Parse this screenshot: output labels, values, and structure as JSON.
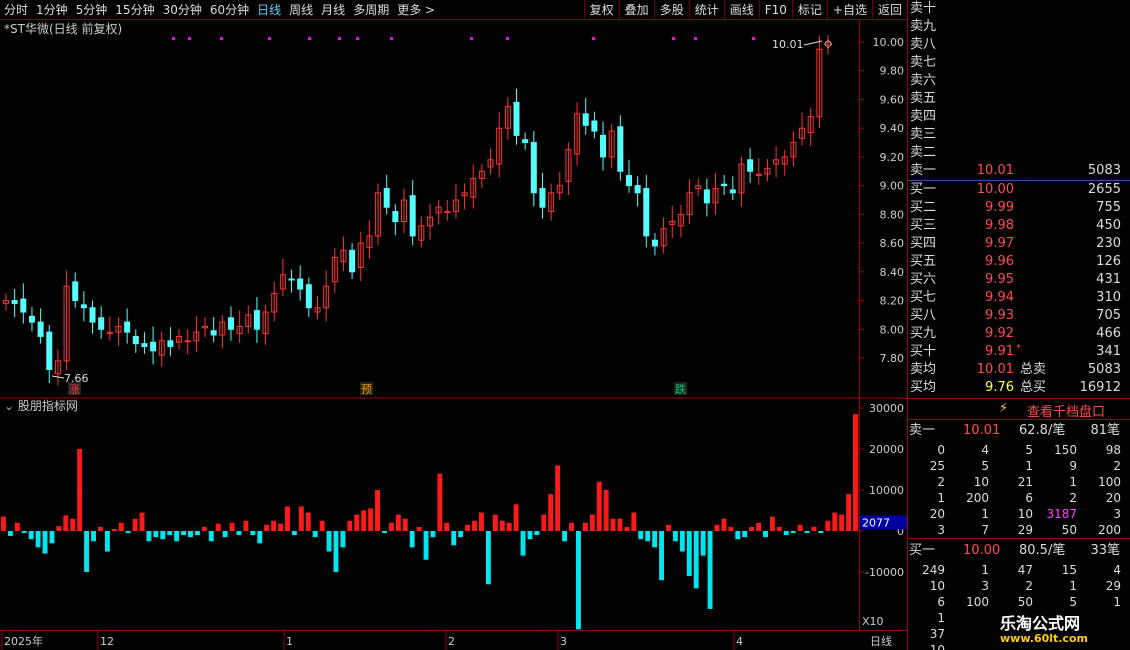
{
  "toolbar": {
    "periods": [
      "分时",
      "1分钟",
      "5分钟",
      "15分钟",
      "30分钟",
      "60分钟",
      "日线",
      "周线",
      "月线",
      "多周期",
      "更多 >"
    ],
    "active_period": "日线",
    "tools": [
      "复权",
      "叠加",
      "多股",
      "统计",
      "画线",
      "F10",
      "标记",
      "+自选",
      "返回"
    ]
  },
  "chart": {
    "title": "*ST华微(日线 前复权)",
    "high_label": "10.01",
    "low_label": "7.66",
    "markers": [
      {
        "text": "涨",
        "color": "#ff4040"
      },
      {
        "text": "预",
        "color": "#ff9900"
      },
      {
        "text": "跌",
        "color": "#00cc66"
      }
    ],
    "price_ticks": [
      "10.00",
      "9.80",
      "9.60",
      "9.40",
      "9.20",
      "9.00",
      "8.80",
      "8.60",
      "8.40",
      "8.20",
      "8.00",
      "7.80"
    ],
    "up_color": "#ff3333",
    "down_color": "#54ffff"
  },
  "indicator": {
    "title": "股朋指标网",
    "ticks": [
      "30000",
      "20000",
      "10000",
      "0",
      "-10000"
    ],
    "current_value": "2077",
    "scale_label": "X10"
  },
  "xaxis": {
    "labels": [
      "2025年",
      "12",
      "1",
      "2",
      "3",
      "4"
    ],
    "period_label": "日线"
  },
  "orderbook": {
    "asks": [
      {
        "label": "卖十",
        "price": "",
        "vol": ""
      },
      {
        "label": "卖九",
        "price": "",
        "vol": ""
      },
      {
        "label": "卖八",
        "price": "",
        "vol": ""
      },
      {
        "label": "卖七",
        "price": "",
        "vol": ""
      },
      {
        "label": "卖六",
        "price": "",
        "vol": ""
      },
      {
        "label": "卖五",
        "price": "",
        "vol": ""
      },
      {
        "label": "卖四",
        "price": "",
        "vol": ""
      },
      {
        "label": "卖三",
        "price": "",
        "vol": ""
      },
      {
        "label": "卖二",
        "price": "",
        "vol": ""
      },
      {
        "label": "卖一",
        "price": "10.01",
        "vol": "5083"
      }
    ],
    "bids": [
      {
        "label": "买一",
        "price": "10.00",
        "vol": "2655"
      },
      {
        "label": "买二",
        "price": "9.99",
        "vol": "755"
      },
      {
        "label": "买三",
        "price": "9.98",
        "vol": "450"
      },
      {
        "label": "买四",
        "price": "9.97",
        "vol": "230"
      },
      {
        "label": "买五",
        "price": "9.96",
        "vol": "126"
      },
      {
        "label": "买六",
        "price": "9.95",
        "vol": "431"
      },
      {
        "label": "买七",
        "price": "9.94",
        "vol": "310"
      },
      {
        "label": "买八",
        "price": "9.93",
        "vol": "705"
      },
      {
        "label": "买九",
        "price": "9.92",
        "vol": "466"
      },
      {
        "label": "买十",
        "price": "9.91",
        "vol": "341"
      }
    ],
    "avg_ask": {
      "label": "卖均",
      "price": "10.01",
      "tlabel": "总卖",
      "total": "5083"
    },
    "avg_bid": {
      "label": "买均",
      "price": "9.76",
      "tlabel": "总买",
      "total": "16912"
    },
    "qiandang": "查看千档盘口",
    "sell1": {
      "label": "卖一",
      "price": "10.01",
      "per": "62.8/笔",
      "count": "81笔"
    },
    "sell1_grid": [
      [
        "0",
        "4",
        "5",
        "150",
        "98"
      ],
      [
        "25",
        "5",
        "1",
        "9",
        "2"
      ],
      [
        "2",
        "10",
        "21",
        "1",
        "100"
      ],
      [
        "1",
        "200",
        "6",
        "2",
        "20"
      ],
      [
        "20",
        "1",
        "10",
        "3187",
        "3"
      ],
      [
        "3",
        "7",
        "29",
        "50",
        "200"
      ]
    ],
    "buy1": {
      "label": "买一",
      "price": "10.00",
      "per": "80.5/笔",
      "count": "33笔"
    },
    "buy1_grid": [
      [
        "249",
        "1",
        "47",
        "15",
        "4"
      ],
      [
        "10",
        "3",
        "2",
        "1",
        "29"
      ],
      [
        "6",
        "100",
        "50",
        "5",
        "1"
      ],
      [
        "1",
        "",
        "",
        "",
        ""
      ],
      [
        "37",
        "",
        "",
        "",
        ""
      ],
      [
        "10",
        "",
        "",
        "",
        ""
      ]
    ]
  },
  "watermark": {
    "line1": "乐淘公式网",
    "line2": "www.60lt.com"
  },
  "chart_data": {
    "type": "bar",
    "title": "股朋指标网",
    "ylim": [
      -20000,
      30000
    ],
    "values": [
      3500,
      -1200,
      2000,
      -500,
      -2000,
      -4000,
      -5500,
      -3000,
      1200,
      3800,
      3000,
      20000,
      -10000,
      -2500,
      1000,
      -5000,
      500,
      2000,
      -500,
      3000,
      4500,
      -2500,
      -1500,
      -2000,
      -1000,
      -2500,
      -1000,
      -1500,
      -1000,
      1000,
      -2500,
      1800,
      -1500,
      2000,
      -1000,
      2500,
      -1000,
      -3000,
      1500,
      2500,
      1800,
      6000,
      -1000,
      6000,
      4500,
      -1500,
      2500,
      -5000,
      -10000,
      -4000,
      2500,
      4000,
      5000,
      5500,
      10000,
      -500,
      2000,
      4000,
      3000,
      -4000,
      1000,
      -7000,
      -1500,
      14000,
      2000,
      -3500,
      -1500,
      1500,
      2500,
      4500,
      -13000,
      4000,
      2500,
      2000,
      6500,
      -6000,
      -2000,
      -1000,
      4000,
      9000,
      16000,
      -2500,
      2000,
      -24000,
      2000,
      4000,
      12000,
      10000,
      3000,
      3000,
      1000,
      4500,
      -2000,
      -2500,
      -4000,
      -12000,
      1500,
      -2500,
      -5000,
      -11000,
      -14000,
      -6000,
      -19000,
      1500,
      3000,
      1000,
      -2000,
      -1500,
      1000,
      2000,
      -1500,
      3500,
      1000,
      -1000,
      -500,
      1500,
      -500,
      1000,
      -500,
      2500,
      4500,
      4000,
      9000,
      28500
    ]
  }
}
